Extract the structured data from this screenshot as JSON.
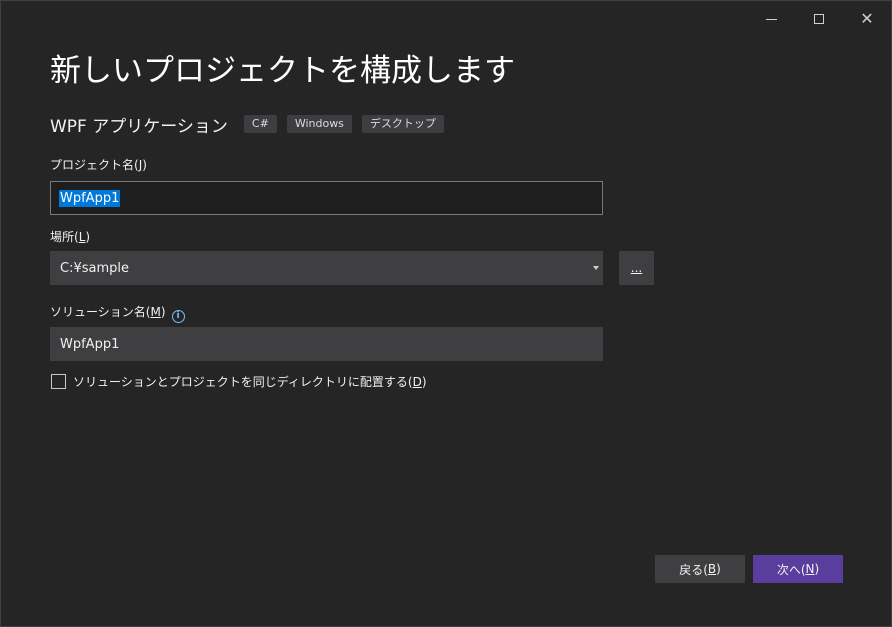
{
  "window_controls": {
    "minimize": "minimize",
    "maximize": "maximize",
    "close": "close"
  },
  "page_title": "新しいプロジェクトを構成します",
  "template": {
    "name": "WPF アプリケーション",
    "tags": [
      "C#",
      "Windows",
      "デスクトップ"
    ]
  },
  "project_name": {
    "label": "プロジェクト名(",
    "accel": "J",
    "label_end": ")",
    "value": "WpfApp1"
  },
  "location": {
    "label": "場所(",
    "accel": "L",
    "label_end": ")",
    "value": "C:¥sample",
    "browse_label": "..."
  },
  "solution_name": {
    "label": "ソリューション名(",
    "accel": "M",
    "label_end": ")",
    "info_icon": "i",
    "value": "WpfApp1"
  },
  "same_dir_checkbox": {
    "label": "ソリューションとプロジェクトを同じディレクトリに配置する(",
    "accel": "D",
    "label_end": ")",
    "checked": false
  },
  "buttons": {
    "back": {
      "label": "戻る(",
      "accel": "B",
      "label_end": ")"
    },
    "next": {
      "label": "次へ(",
      "accel": "N",
      "label_end": ")"
    }
  },
  "colors": {
    "background": "#252526",
    "input_bg": "#3f3f41",
    "selection": "#0078d7",
    "primary_button": "#5a3e9e",
    "info_icon": "#75beff"
  }
}
